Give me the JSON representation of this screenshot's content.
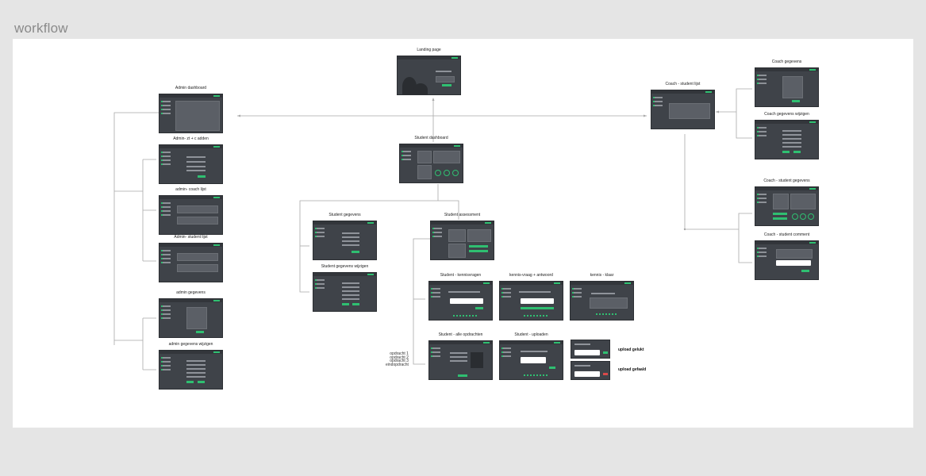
{
  "page": {
    "title": "workflow"
  },
  "frames": {
    "landing": "Landing page",
    "admin_dashboard": "Admin dashboard",
    "admin_add": "Admin- zt + c adden",
    "admin_coach_list": "admin- coach lijst",
    "admin_student_list": "Admin- student lijst",
    "admin_data": "admin gegevens",
    "admin_edit": "admin gegevens wijzigen",
    "student_dashboard": "Student dashboard",
    "student_data": "Student gegevens",
    "student_edit": "Student gegevens wijzigen",
    "student_assessment": "Student assessment",
    "student_questions": "Student - kennisvragen",
    "knowledge_question_answer": "kennis-vraag + antwoord",
    "knowledge_done": "kennis - klaar",
    "student_all_assignments": "Student - alle opdrachten",
    "student_upload": "Student - uploaden",
    "coach_student_list": "Coach - student lijst",
    "coach_data": "Coach gegevens",
    "coach_edit": "Coach gegevens wijzigen",
    "coach_student_data": "Coach - student gegevens",
    "coach_student_comment": "Coach - student comment"
  },
  "notes": {
    "upload_success": "upload gelukt",
    "upload_failed": "upload gefaald"
  },
  "side_labels": [
    "opdracht 1",
    "opdracht 2",
    "opdracht 3",
    "eindopdracht"
  ]
}
